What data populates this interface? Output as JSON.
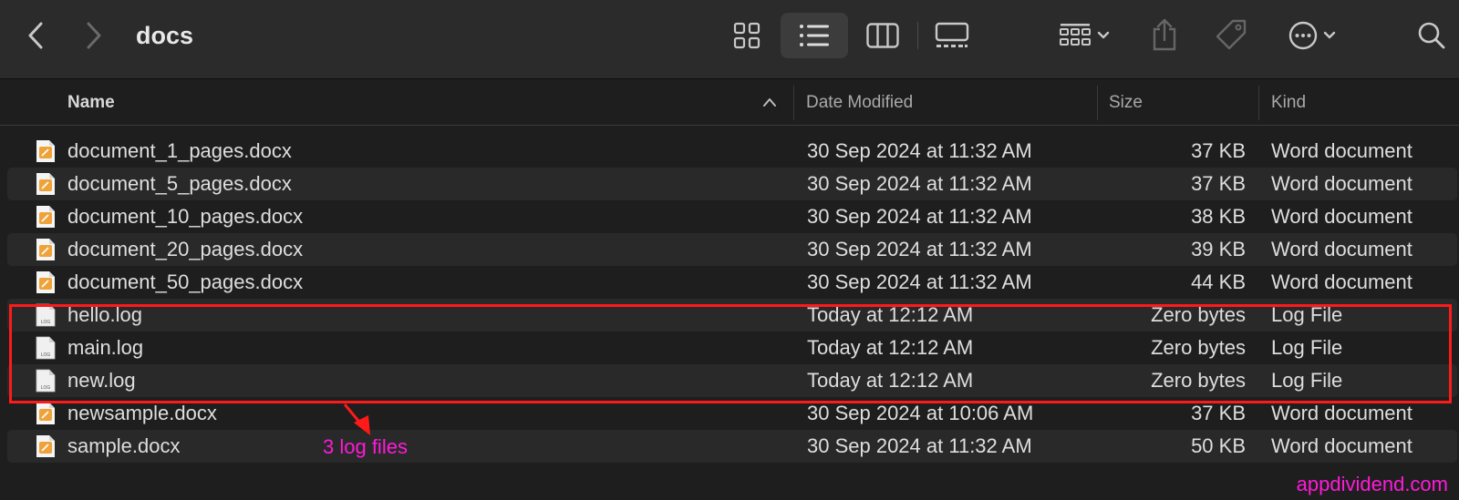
{
  "toolbar": {
    "title": "docs",
    "icons": [
      "chevron-left-icon",
      "chevron-right-icon",
      "icon-view-icon",
      "list-view-icon",
      "column-view-icon",
      "gallery-view-icon",
      "group-icon",
      "share-icon",
      "tag-icon",
      "more-icon",
      "search-icon"
    ]
  },
  "columns": {
    "name": "Name",
    "date": "Date Modified",
    "size": "Size",
    "kind": "Kind"
  },
  "files": [
    {
      "name": "document_1_pages.docx",
      "date": "30 Sep 2024 at 11:32 AM",
      "size": "37 KB",
      "kind": "Word document",
      "type": "docx"
    },
    {
      "name": "document_5_pages.docx",
      "date": "30 Sep 2024 at 11:32 AM",
      "size": "37 KB",
      "kind": "Word document",
      "type": "docx"
    },
    {
      "name": "document_10_pages.docx",
      "date": "30 Sep 2024 at 11:32 AM",
      "size": "38 KB",
      "kind": "Word document",
      "type": "docx"
    },
    {
      "name": "document_20_pages.docx",
      "date": "30 Sep 2024 at 11:32 AM",
      "size": "39 KB",
      "kind": "Word document",
      "type": "docx"
    },
    {
      "name": "document_50_pages.docx",
      "date": "30 Sep 2024 at 11:32 AM",
      "size": "44 KB",
      "kind": "Word document",
      "type": "docx"
    },
    {
      "name": "hello.log",
      "date": "Today at 12:12 AM",
      "size": "Zero bytes",
      "kind": "Log File",
      "type": "log"
    },
    {
      "name": "main.log",
      "date": "Today at 12:12 AM",
      "size": "Zero bytes",
      "kind": "Log File",
      "type": "log"
    },
    {
      "name": "new.log",
      "date": "Today at 12:12 AM",
      "size": "Zero bytes",
      "kind": "Log File",
      "type": "log"
    },
    {
      "name": "newsample.docx",
      "date": "30 Sep 2024 at 10:06 AM",
      "size": "37 KB",
      "kind": "Word document",
      "type": "docx"
    },
    {
      "name": "sample.docx",
      "date": "30 Sep 2024 at 11:32 AM",
      "size": "50 KB",
      "kind": "Word document",
      "type": "docx"
    }
  ],
  "log_icon_text": "LOG",
  "annotation": {
    "text": "3 log files",
    "color": "#ff1ad9",
    "box_color": "#ff1a1a"
  },
  "watermark": "appdividend.com",
  "colors": {
    "background": "#1e1e1e",
    "toolbar": "#2b2b2b",
    "docx_icon": "#f0a23a"
  }
}
